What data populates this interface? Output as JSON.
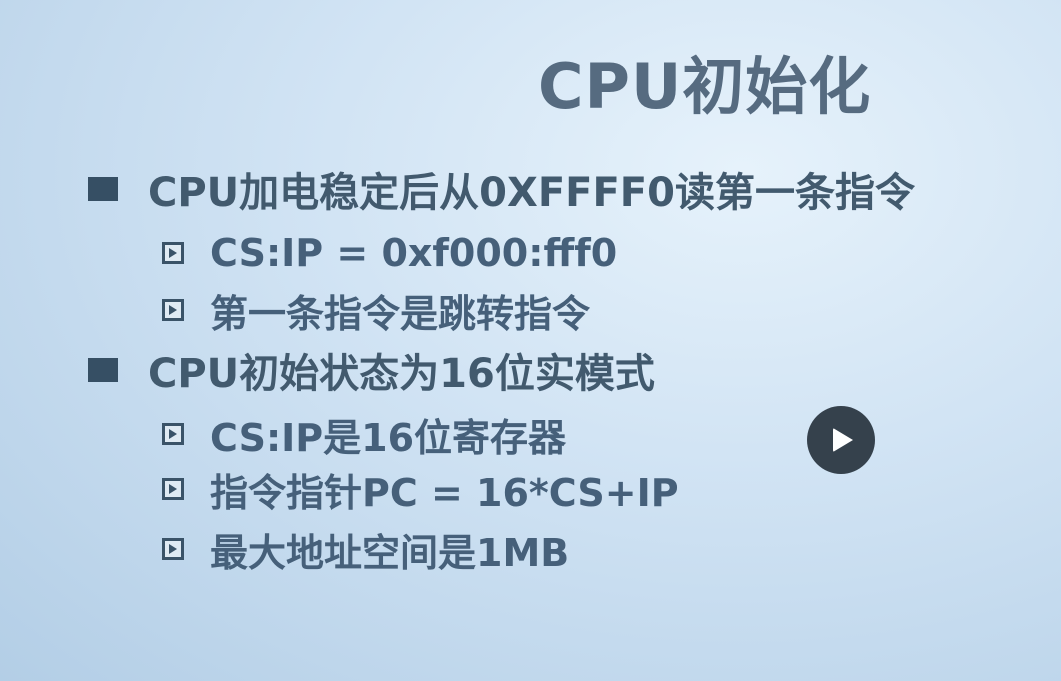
{
  "slide": {
    "title": "CPU初始化",
    "bullets": [
      {
        "text": "CPU加电稳定后从0XFFFF0读第一条指令",
        "sub": [
          "CS:IP = 0xf000:fff0",
          "第一条指令是跳转指令"
        ]
      },
      {
        "text": "CPU初始状态为16位实模式",
        "sub": [
          "CS:IP是16位寄存器",
          "指令指针PC = 16*CS+IP",
          "最大地址空间是1MB"
        ]
      }
    ]
  },
  "player": {
    "play_icon": "play-icon"
  },
  "colors": {
    "title": "#566b80",
    "text": "#425a6e",
    "marker": "#364f64",
    "play_button": "#35414c"
  }
}
